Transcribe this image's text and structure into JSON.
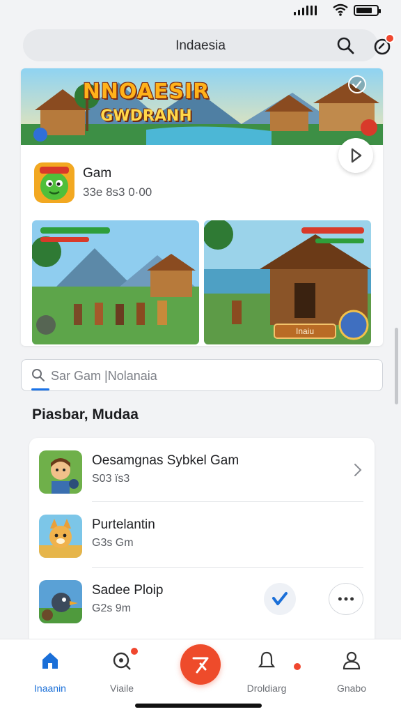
{
  "status_bar": {
    "signal": "signal-icon",
    "wifi": "wifi-icon",
    "battery": "battery-icon",
    "battery_level": 0.8
  },
  "topbar": {
    "title": "Indaesia",
    "search_icon": "search-icon",
    "notification_icon": "notification-icon",
    "notification_badge": "",
    "badge_color": "#f0472f"
  },
  "featured": {
    "banner_title": "NNOAESIR",
    "banner_subtitle": "GWDRANH",
    "play_icon": "play-icon",
    "verified_icon": "check-circle-icon",
    "app_name": "Gam",
    "app_meta": "33e 8s3 0·00",
    "screenshots": [
      {
        "name": "village-screenshot"
      },
      {
        "name": "hut-screenshot",
        "button_label": "Inaiu"
      }
    ]
  },
  "search": {
    "placeholder": "Sar Gam |Nolanaia",
    "icon": "search-icon",
    "accent": "#1a73e8"
  },
  "section": {
    "title": "Piasbar, Mudaa"
  },
  "list": {
    "items": [
      {
        "name": "Oesamgnas Sybkel Gam",
        "sub": "S03 ïs3",
        "thumb": "character-thumb",
        "action": "chevron-right-icon"
      },
      {
        "name": "Purtelantin",
        "sub": "G3s Gm",
        "thumb": "fox-thumb",
        "action": ""
      },
      {
        "name": "Sadee Ploip",
        "sub": "G2s 9m",
        "thumb": "bird-thumb",
        "action": "check-and-more"
      }
    ]
  },
  "bottom_nav": {
    "items": [
      {
        "label": "Inaanin",
        "icon": "home-icon"
      },
      {
        "label": "Viaile",
        "icon": "search-icon"
      },
      {
        "label": "",
        "icon": "create-icon"
      },
      {
        "label": "Droldiarg",
        "icon": "notification-icon"
      },
      {
        "label": "Gnabo",
        "icon": "profile-icon"
      }
    ],
    "active_color": "#1a6fd8",
    "fab_color": "#ee4b2b"
  }
}
